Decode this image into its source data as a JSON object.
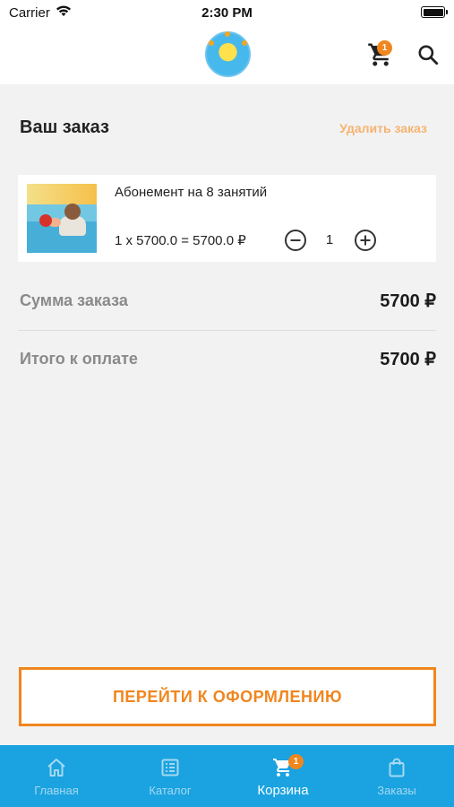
{
  "status_bar": {
    "carrier": "Carrier",
    "time": "2:30 PM"
  },
  "header": {
    "cart_badge": "1",
    "logo_icon": "logo-sun",
    "cart_icon": "cart-icon",
    "search_icon": "search-icon"
  },
  "order": {
    "title": "Ваш заказ",
    "delete_label": "Удалить заказ"
  },
  "cart_item": {
    "name": "Абонемент на 8 занятий",
    "calc": "1 x 5700.0 = 5700.0 ₽",
    "quantity": "1"
  },
  "summary": {
    "subtotal_label": "Сумма заказа",
    "subtotal_value": "5700 ₽",
    "total_label": "Итого к оплате",
    "total_value": "5700 ₽"
  },
  "checkout_label": "ПЕРЕЙТИ К ОФОРМЛЕНИЮ",
  "tabs": [
    {
      "label": "Главная",
      "icon": "home-icon"
    },
    {
      "label": "Каталог",
      "icon": "catalog-icon"
    },
    {
      "label": "Корзина",
      "icon": "cart-icon",
      "badge": "1",
      "active": true
    },
    {
      "label": "Заказы",
      "icon": "bag-icon"
    }
  ],
  "colors": {
    "accent": "#f0861e",
    "tabbar": "#1aa3e0",
    "delete": "#f6b36f"
  }
}
